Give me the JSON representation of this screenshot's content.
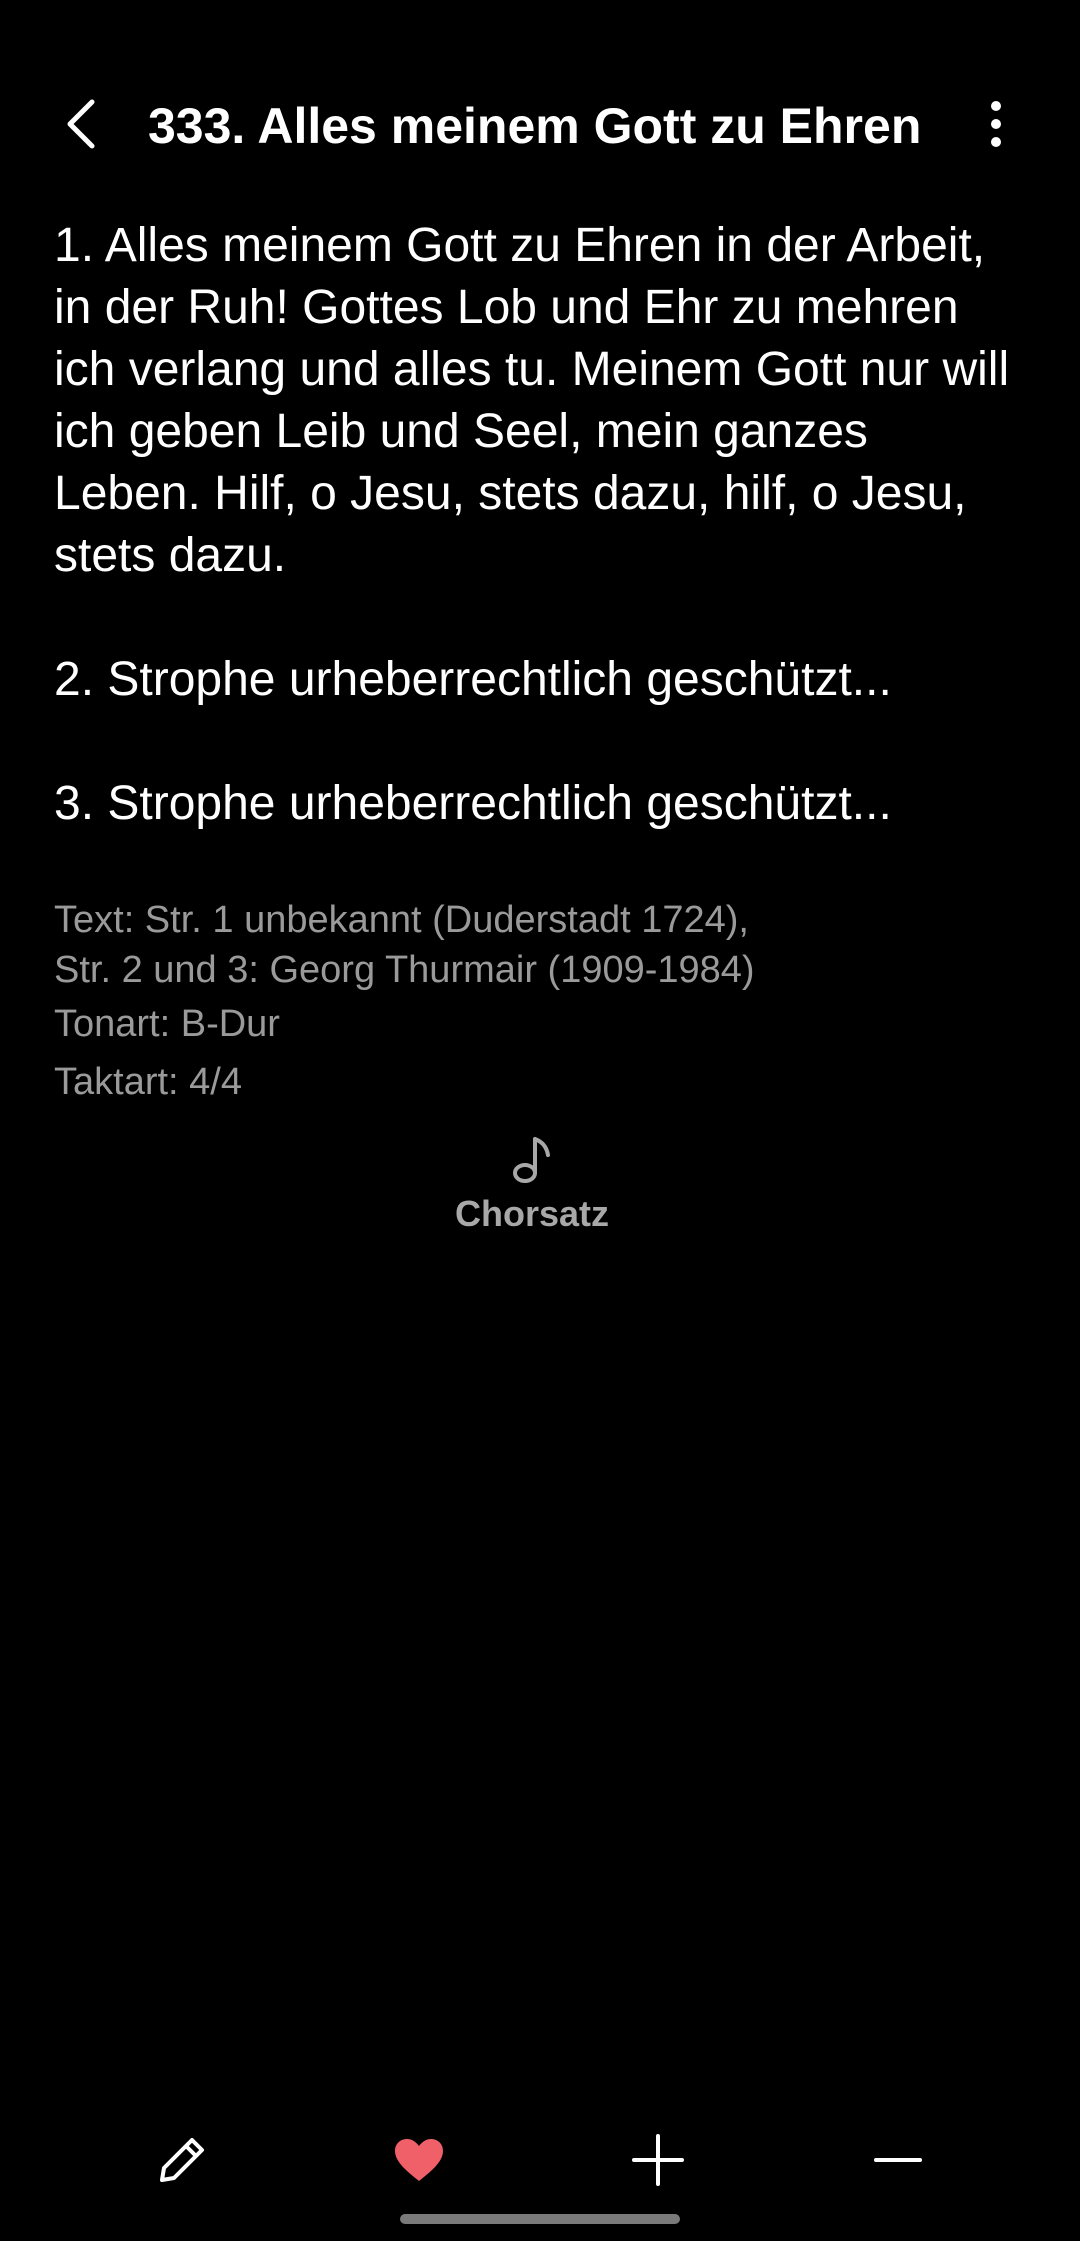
{
  "header": {
    "title": "333. Alles meinem Gott zu Ehren",
    "back_icon": "chevron-left-icon",
    "more_icon": "more-vertical-icon"
  },
  "verses": [
    "1. Alles meinem Gott zu Ehren in der Arbeit, in der Ruh! Gottes Lob und Ehr zu mehren ich verlang und alles tu. Meinem Gott nur will ich geben Leib und Seel, mein ganzes Leben. Hilf, o Jesu, stets dazu, hilf, o Jesu, stets dazu.",
    "2. Strophe urheberrechtlich geschützt...",
    "3. Strophe urheberrechtlich geschützt..."
  ],
  "meta": {
    "text_line1": "Text: Str. 1 unbekannt (Duderstadt 1724),",
    "text_line2": "Str. 2 und 3: Georg Thurmair (1909-1984)",
    "tonart": "Tonart: B-Dur",
    "taktart": "Taktart: 4/4"
  },
  "chorsatz": {
    "label": "Chorsatz",
    "icon": "music-note-icon"
  },
  "bottom_bar": {
    "edit_icon": "pencil-icon",
    "favorite_icon": "heart-icon",
    "zoom_in_icon": "plus-icon",
    "zoom_out_icon": "minus-icon"
  },
  "colors": {
    "background": "#000000",
    "text": "#ffffff",
    "secondary_text": "#9a9a9a",
    "favorite": "#f06068"
  }
}
